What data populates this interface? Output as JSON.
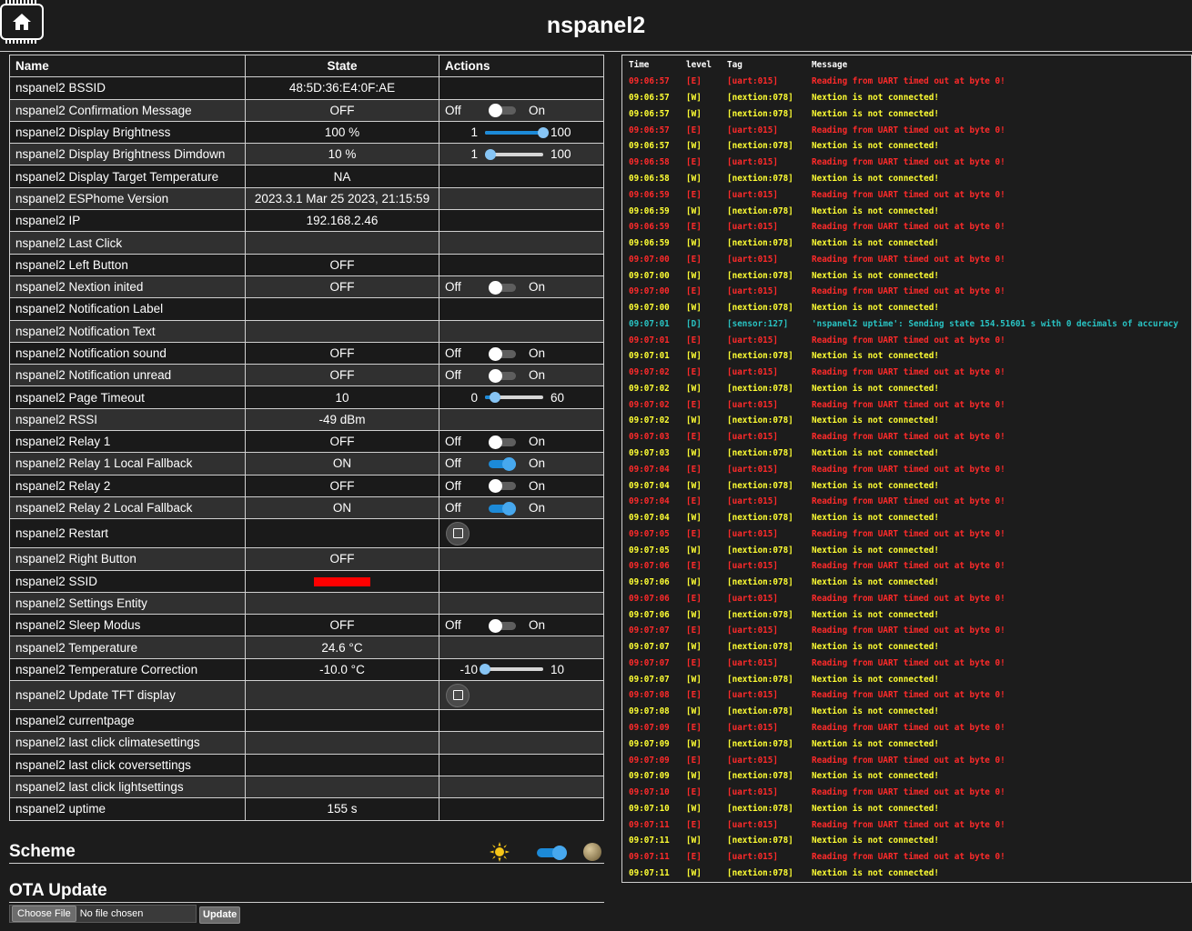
{
  "header": {
    "title": "nspanel2",
    "home_icon": "home-icon"
  },
  "table": {
    "headers": {
      "name": "Name",
      "state": "State",
      "actions": "Actions"
    },
    "rows": [
      {
        "name": "nspanel2 BSSID",
        "state": "48:5D:36:E4:0F:AE",
        "action": "none"
      },
      {
        "name": "nspanel2 Confirmation Message",
        "state": "OFF",
        "action": "switch",
        "off": "Off",
        "on": "On",
        "checked": false
      },
      {
        "name": "nspanel2 Display Brightness",
        "state": "100 %",
        "action": "slider",
        "min": "1",
        "max": "100",
        "level": 1.0
      },
      {
        "name": "nspanel2 Display Brightness Dimdown",
        "state": "10 %",
        "action": "slider",
        "min": "1",
        "max": "100",
        "level": 0.09
      },
      {
        "name": "nspanel2 Display Target Temperature",
        "state": "NA",
        "action": "none"
      },
      {
        "name": "nspanel2 ESPhome Version",
        "state": "2023.3.1 Mar 25 2023, 21:15:59",
        "action": "none"
      },
      {
        "name": "nspanel2 IP",
        "state": "192.168.2.46",
        "action": "none"
      },
      {
        "name": "nspanel2 Last Click",
        "state": "",
        "action": "none"
      },
      {
        "name": "nspanel2 Left Button",
        "state": "OFF",
        "action": "none"
      },
      {
        "name": "nspanel2 Nextion inited",
        "state": "OFF",
        "action": "switch",
        "off": "Off",
        "on": "On",
        "checked": false
      },
      {
        "name": "nspanel2 Notification Label",
        "state": "",
        "action": "none"
      },
      {
        "name": "nspanel2 Notification Text",
        "state": "",
        "action": "none"
      },
      {
        "name": "nspanel2 Notification sound",
        "state": "OFF",
        "action": "switch",
        "off": "Off",
        "on": "On",
        "checked": false
      },
      {
        "name": "nspanel2 Notification unread",
        "state": "OFF",
        "action": "switch",
        "off": "Off",
        "on": "On",
        "checked": false
      },
      {
        "name": "nspanel2 Page Timeout",
        "state": "10",
        "action": "slider",
        "min": "0",
        "max": "60",
        "level": 0.17
      },
      {
        "name": "nspanel2 RSSI",
        "state": "-49 dBm",
        "action": "none"
      },
      {
        "name": "nspanel2 Relay 1",
        "state": "OFF",
        "action": "switch",
        "off": "Off",
        "on": "On",
        "checked": false
      },
      {
        "name": "nspanel2 Relay 1 Local Fallback",
        "state": "ON",
        "action": "switch",
        "off": "Off",
        "on": "On",
        "checked": true
      },
      {
        "name": "nspanel2 Relay 2",
        "state": "OFF",
        "action": "switch",
        "off": "Off",
        "on": "On",
        "checked": false
      },
      {
        "name": "nspanel2 Relay 2 Local Fallback",
        "state": "ON",
        "action": "switch",
        "off": "Off",
        "on": "On",
        "checked": true
      },
      {
        "name": "nspanel2 Restart",
        "state": "",
        "action": "button"
      },
      {
        "name": "nspanel2 Right Button",
        "state": "OFF",
        "action": "none"
      },
      {
        "name": "nspanel2 SSID",
        "state": "",
        "action": "none",
        "redacted": true
      },
      {
        "name": "nspanel2 Settings Entity",
        "state": "",
        "action": "none"
      },
      {
        "name": "nspanel2 Sleep Modus",
        "state": "OFF",
        "action": "switch",
        "off": "Off",
        "on": "On",
        "checked": false
      },
      {
        "name": "nspanel2 Temperature",
        "state": "24.6 °C",
        "action": "none"
      },
      {
        "name": "nspanel2 Temperature Correction",
        "state": "-10.0 °C",
        "action": "slider",
        "min": "-10",
        "max": "10",
        "level": 0.0
      },
      {
        "name": "nspanel2 Update TFT display",
        "state": "",
        "action": "button"
      },
      {
        "name": "nspanel2 currentpage",
        "state": "",
        "action": "none"
      },
      {
        "name": "nspanel2 last click climatesettings",
        "state": "",
        "action": "none"
      },
      {
        "name": "nspanel2 last click coversettings",
        "state": "",
        "action": "none"
      },
      {
        "name": "nspanel2 last click lightsettings",
        "state": "",
        "action": "none"
      },
      {
        "name": "nspanel2 uptime",
        "state": "155 s",
        "action": "none"
      }
    ]
  },
  "scheme": {
    "title": "Scheme",
    "dark": true,
    "sun_icon": "sun-icon",
    "moon_icon": "moon-icon"
  },
  "ota": {
    "title": "OTA Update",
    "choose_label": "Choose File",
    "no_file": "No file chosen",
    "update_label": "Update"
  },
  "log": {
    "headers": {
      "time": "Time",
      "level": "level",
      "tag": "Tag",
      "message": "Message"
    },
    "colors": {
      "E": "#ff2a2a",
      "W": "#ffff33",
      "D": "#29c3c3"
    },
    "rows": [
      {
        "time": "09:06:57",
        "level": "[E]",
        "tag": "[uart:015]",
        "msg": "Reading from UART timed out at byte 0!"
      },
      {
        "time": "09:06:57",
        "level": "[W]",
        "tag": "[nextion:078]",
        "msg": "Nextion is not connected!"
      },
      {
        "time": "09:06:57",
        "level": "[W]",
        "tag": "[nextion:078]",
        "msg": "Nextion is not connected!"
      },
      {
        "time": "09:06:57",
        "level": "[E]",
        "tag": "[uart:015]",
        "msg": "Reading from UART timed out at byte 0!"
      },
      {
        "time": "09:06:57",
        "level": "[W]",
        "tag": "[nextion:078]",
        "msg": "Nextion is not connected!"
      },
      {
        "time": "09:06:58",
        "level": "[E]",
        "tag": "[uart:015]",
        "msg": "Reading from UART timed out at byte 0!"
      },
      {
        "time": "09:06:58",
        "level": "[W]",
        "tag": "[nextion:078]",
        "msg": "Nextion is not connected!"
      },
      {
        "time": "09:06:59",
        "level": "[E]",
        "tag": "[uart:015]",
        "msg": "Reading from UART timed out at byte 0!"
      },
      {
        "time": "09:06:59",
        "level": "[W]",
        "tag": "[nextion:078]",
        "msg": "Nextion is not connected!"
      },
      {
        "time": "09:06:59",
        "level": "[E]",
        "tag": "[uart:015]",
        "msg": "Reading from UART timed out at byte 0!"
      },
      {
        "time": "09:06:59",
        "level": "[W]",
        "tag": "[nextion:078]",
        "msg": "Nextion is not connected!"
      },
      {
        "time": "09:07:00",
        "level": "[E]",
        "tag": "[uart:015]",
        "msg": "Reading from UART timed out at byte 0!"
      },
      {
        "time": "09:07:00",
        "level": "[W]",
        "tag": "[nextion:078]",
        "msg": "Nextion is not connected!"
      },
      {
        "time": "09:07:00",
        "level": "[E]",
        "tag": "[uart:015]",
        "msg": "Reading from UART timed out at byte 0!"
      },
      {
        "time": "09:07:00",
        "level": "[W]",
        "tag": "[nextion:078]",
        "msg": "Nextion is not connected!"
      },
      {
        "time": "09:07:01",
        "level": "[D]",
        "tag": "[sensor:127]",
        "msg": "'nspanel2 uptime': Sending state 154.51601 s with 0 decimals of accuracy"
      },
      {
        "time": "09:07:01",
        "level": "[E]",
        "tag": "[uart:015]",
        "msg": "Reading from UART timed out at byte 0!"
      },
      {
        "time": "09:07:01",
        "level": "[W]",
        "tag": "[nextion:078]",
        "msg": "Nextion is not connected!"
      },
      {
        "time": "09:07:02",
        "level": "[E]",
        "tag": "[uart:015]",
        "msg": "Reading from UART timed out at byte 0!"
      },
      {
        "time": "09:07:02",
        "level": "[W]",
        "tag": "[nextion:078]",
        "msg": "Nextion is not connected!"
      },
      {
        "time": "09:07:02",
        "level": "[E]",
        "tag": "[uart:015]",
        "msg": "Reading from UART timed out at byte 0!"
      },
      {
        "time": "09:07:02",
        "level": "[W]",
        "tag": "[nextion:078]",
        "msg": "Nextion is not connected!"
      },
      {
        "time": "09:07:03",
        "level": "[E]",
        "tag": "[uart:015]",
        "msg": "Reading from UART timed out at byte 0!"
      },
      {
        "time": "09:07:03",
        "level": "[W]",
        "tag": "[nextion:078]",
        "msg": "Nextion is not connected!"
      },
      {
        "time": "09:07:04",
        "level": "[E]",
        "tag": "[uart:015]",
        "msg": "Reading from UART timed out at byte 0!"
      },
      {
        "time": "09:07:04",
        "level": "[W]",
        "tag": "[nextion:078]",
        "msg": "Nextion is not connected!"
      },
      {
        "time": "09:07:04",
        "level": "[E]",
        "tag": "[uart:015]",
        "msg": "Reading from UART timed out at byte 0!"
      },
      {
        "time": "09:07:04",
        "level": "[W]",
        "tag": "[nextion:078]",
        "msg": "Nextion is not connected!"
      },
      {
        "time": "09:07:05",
        "level": "[E]",
        "tag": "[uart:015]",
        "msg": "Reading from UART timed out at byte 0!"
      },
      {
        "time": "09:07:05",
        "level": "[W]",
        "tag": "[nextion:078]",
        "msg": "Nextion is not connected!"
      },
      {
        "time": "09:07:06",
        "level": "[E]",
        "tag": "[uart:015]",
        "msg": "Reading from UART timed out at byte 0!"
      },
      {
        "time": "09:07:06",
        "level": "[W]",
        "tag": "[nextion:078]",
        "msg": "Nextion is not connected!"
      },
      {
        "time": "09:07:06",
        "level": "[E]",
        "tag": "[uart:015]",
        "msg": "Reading from UART timed out at byte 0!"
      },
      {
        "time": "09:07:06",
        "level": "[W]",
        "tag": "[nextion:078]",
        "msg": "Nextion is not connected!"
      },
      {
        "time": "09:07:07",
        "level": "[E]",
        "tag": "[uart:015]",
        "msg": "Reading from UART timed out at byte 0!"
      },
      {
        "time": "09:07:07",
        "level": "[W]",
        "tag": "[nextion:078]",
        "msg": "Nextion is not connected!"
      },
      {
        "time": "09:07:07",
        "level": "[E]",
        "tag": "[uart:015]",
        "msg": "Reading from UART timed out at byte 0!"
      },
      {
        "time": "09:07:07",
        "level": "[W]",
        "tag": "[nextion:078]",
        "msg": "Nextion is not connected!"
      },
      {
        "time": "09:07:08",
        "level": "[E]",
        "tag": "[uart:015]",
        "msg": "Reading from UART timed out at byte 0!"
      },
      {
        "time": "09:07:08",
        "level": "[W]",
        "tag": "[nextion:078]",
        "msg": "Nextion is not connected!"
      },
      {
        "time": "09:07:09",
        "level": "[E]",
        "tag": "[uart:015]",
        "msg": "Reading from UART timed out at byte 0!"
      },
      {
        "time": "09:07:09",
        "level": "[W]",
        "tag": "[nextion:078]",
        "msg": "Nextion is not connected!"
      },
      {
        "time": "09:07:09",
        "level": "[E]",
        "tag": "[uart:015]",
        "msg": "Reading from UART timed out at byte 0!"
      },
      {
        "time": "09:07:09",
        "level": "[W]",
        "tag": "[nextion:078]",
        "msg": "Nextion is not connected!"
      },
      {
        "time": "09:07:10",
        "level": "[E]",
        "tag": "[uart:015]",
        "msg": "Reading from UART timed out at byte 0!"
      },
      {
        "time": "09:07:10",
        "level": "[W]",
        "tag": "[nextion:078]",
        "msg": "Nextion is not connected!"
      },
      {
        "time": "09:07:11",
        "level": "[E]",
        "tag": "[uart:015]",
        "msg": "Reading from UART timed out at byte 0!"
      },
      {
        "time": "09:07:11",
        "level": "[W]",
        "tag": "[nextion:078]",
        "msg": "Nextion is not connected!"
      },
      {
        "time": "09:07:11",
        "level": "[E]",
        "tag": "[uart:015]",
        "msg": "Reading from UART timed out at byte 0!"
      },
      {
        "time": "09:07:11",
        "level": "[W]",
        "tag": "[nextion:078]",
        "msg": "Nextion is not connected!"
      }
    ]
  }
}
